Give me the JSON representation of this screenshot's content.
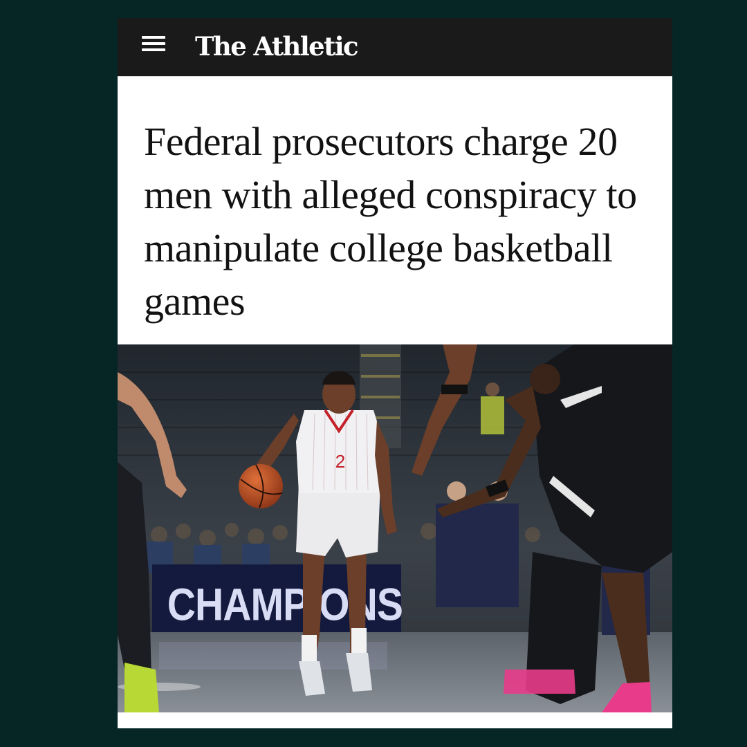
{
  "header": {
    "brand": "The Athletic",
    "menu_icon": "hamburger-menu-icon"
  },
  "article": {
    "headline": "Federal prosecutors charge 20 men with alleged conspiracy to manipulate college basketball games"
  },
  "photo": {
    "banner_text": "CHAMPIONS",
    "jersey_number": "2"
  },
  "colors": {
    "page_background": "#062626",
    "header_background": "#1a1a1a",
    "card_background": "#ffffff",
    "headline_text": "#121212"
  }
}
